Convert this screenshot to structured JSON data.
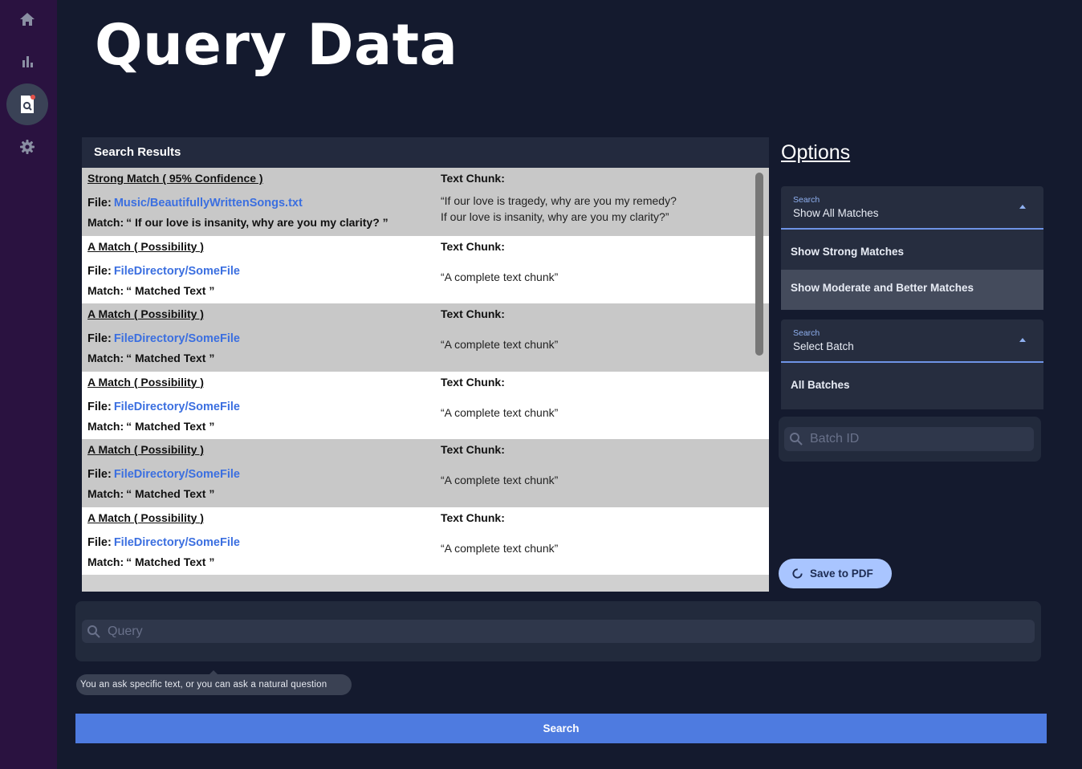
{
  "nav": {
    "items": [
      {
        "icon": "home-icon",
        "active": false
      },
      {
        "icon": "bar-chart-icon",
        "active": false
      },
      {
        "icon": "document-search-icon",
        "active": true
      },
      {
        "icon": "gear-icon",
        "active": false
      }
    ]
  },
  "page": {
    "title": "Query Data"
  },
  "results": {
    "header": "Search Results",
    "rows": [
      {
        "title": "Strong Match ( 95% Confidence )",
        "file_label": "File:",
        "file": "Music/BeautifullyWrittenSongs.txt",
        "match_label": "Match:",
        "match": "“ If our love is insanity, why are you my clarity? ”",
        "chunk_label": "Text Chunk:",
        "chunk": "“If our love is tragedy, why are you my remedy?\nIf our love is insanity, why are you my clarity?”"
      },
      {
        "title": "A Match ( Possibility )",
        "file_label": "File:",
        "file": "FileDirectory/SomeFile",
        "match_label": "Match:",
        "match": "“ Matched Text ”",
        "chunk_label": "Text Chunk:",
        "chunk": "“A complete text chunk”"
      },
      {
        "title": "A Match ( Possibility )",
        "file_label": "File:",
        "file": "FileDirectory/SomeFile",
        "match_label": "Match:",
        "match": "“ Matched Text ”",
        "chunk_label": "Text Chunk:",
        "chunk": "“A complete text chunk”"
      },
      {
        "title": "A Match ( Possibility )",
        "file_label": "File:",
        "file": "FileDirectory/SomeFile",
        "match_label": "Match:",
        "match": "“ Matched Text ”",
        "chunk_label": "Text Chunk:",
        "chunk": "“A complete text chunk”"
      },
      {
        "title": "A Match ( Possibility )",
        "file_label": "File:",
        "file": "FileDirectory/SomeFile",
        "match_label": "Match:",
        "match": "“ Matched Text ”",
        "chunk_label": "Text Chunk:",
        "chunk": "“A complete text chunk”"
      },
      {
        "title": "A Match ( Possibility )",
        "file_label": "File:",
        "file": "FileDirectory/SomeFile",
        "match_label": "Match:",
        "match": "“ Matched Text ”",
        "chunk_label": "Text Chunk:",
        "chunk": "“A complete text chunk”"
      }
    ]
  },
  "options": {
    "title": "Options",
    "match_select": {
      "label": "Search",
      "value": "Show All Matches",
      "options": [
        "Show Strong Matches",
        "Show Moderate and Better Matches"
      ]
    },
    "batch_select": {
      "label": "Search",
      "value": "Select Batch",
      "options": [
        "All Batches"
      ]
    },
    "batch_id_placeholder": "Batch ID",
    "save_label": "Save to PDF"
  },
  "query": {
    "placeholder": "Query",
    "hint": "You an ask specific text, or you can ask a natural question",
    "search_label": "Search"
  },
  "colors": {
    "sidebar": "#2a1240",
    "background": "#141a2e",
    "accent": "#4e7be0",
    "link": "#3b6fe0"
  }
}
